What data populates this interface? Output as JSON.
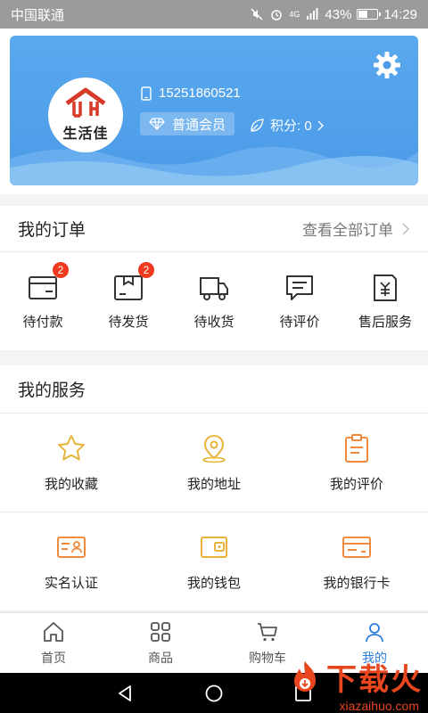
{
  "status_bar": {
    "carrier": "中国联通",
    "network": "4G",
    "battery": "43%",
    "battery_level": 0.43,
    "time": "14:29"
  },
  "profile": {
    "avatar_logo_text": "生活佳",
    "phone": "15251860521",
    "member_level": "普通会员",
    "points_label": "积分: 0"
  },
  "orders": {
    "title": "我的订单",
    "view_all": "查看全部订单",
    "items": [
      {
        "label": "待付款",
        "badge": "2",
        "icon": "wallet-icon"
      },
      {
        "label": "待发货",
        "badge": "2",
        "icon": "package-icon"
      },
      {
        "label": "待收货",
        "badge": "",
        "icon": "truck-icon"
      },
      {
        "label": "待评价",
        "badge": "",
        "icon": "comment-icon"
      },
      {
        "label": "售后服务",
        "badge": "",
        "icon": "refund-icon"
      }
    ]
  },
  "services": {
    "title": "我的服务",
    "items": [
      {
        "label": "我的收藏",
        "icon": "star-icon"
      },
      {
        "label": "我的地址",
        "icon": "location-pin-icon"
      },
      {
        "label": "我的评价",
        "icon": "clipboard-icon"
      },
      {
        "label": "实名认证",
        "icon": "id-card-icon"
      },
      {
        "label": "我的钱包",
        "icon": "wallet-icon"
      },
      {
        "label": "我的银行卡",
        "icon": "bank-card-icon"
      }
    ]
  },
  "tabbar": {
    "items": [
      {
        "label": "首页",
        "icon": "home-icon"
      },
      {
        "label": "商品",
        "icon": "grid-icon"
      },
      {
        "label": "购物车",
        "icon": "cart-icon"
      },
      {
        "label": "我的",
        "icon": "user-icon",
        "active": true
      }
    ]
  },
  "watermark": {
    "text": "下载火",
    "url": "xiazaihuo.com"
  },
  "colors": {
    "accent": "#2a7de1",
    "card_blue": "#4a9ae8",
    "badge_red": "#f0391f",
    "icon_orange": "#ef8a3c",
    "icon_gold": "#e8b43a"
  }
}
